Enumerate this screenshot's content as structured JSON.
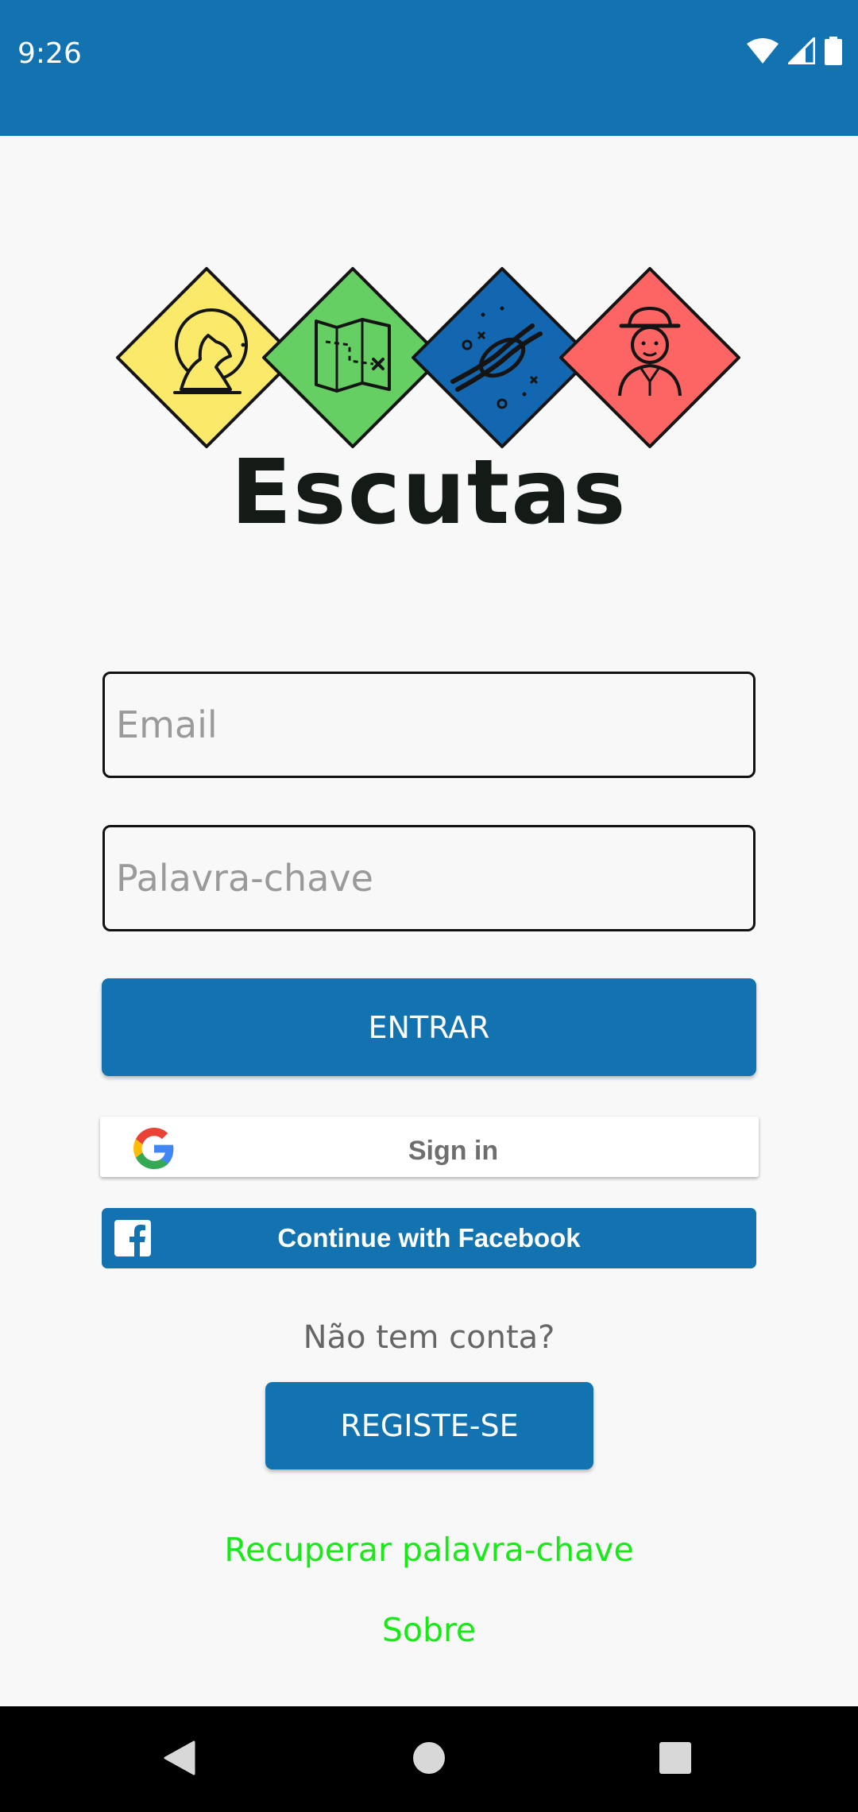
{
  "status_bar": {
    "time": "9:26",
    "icons": [
      "wifi-icon",
      "cell-signal-icon",
      "battery-icon"
    ]
  },
  "logo": {
    "tiles": [
      {
        "icon": "wolf-moon-icon",
        "color": "#fbe96a"
      },
      {
        "icon": "treasure-map-icon",
        "color": "#66cf63"
      },
      {
        "icon": "rope-knot-icon",
        "color": "#1367b0"
      },
      {
        "icon": "scout-person-icon",
        "color": "#fc6563"
      }
    ]
  },
  "app": {
    "title": "Escutas"
  },
  "form": {
    "email_placeholder": "Email",
    "password_placeholder": "Palavra-chave",
    "login_label": "ENTRAR"
  },
  "social": {
    "google_label": "Sign in",
    "facebook_label": "Continue with Facebook"
  },
  "register": {
    "prompt": "Não tem conta?",
    "button_label": "REGISTE-SE"
  },
  "links": {
    "recover_password": "Recuperar palavra-chave",
    "about": "Sobre"
  },
  "colors": {
    "primary": "#1372b0",
    "link": "#19e819",
    "background": "#f8f8f8"
  },
  "nav_bar": {
    "buttons": [
      "back-icon",
      "home-icon",
      "recent-apps-icon"
    ]
  }
}
